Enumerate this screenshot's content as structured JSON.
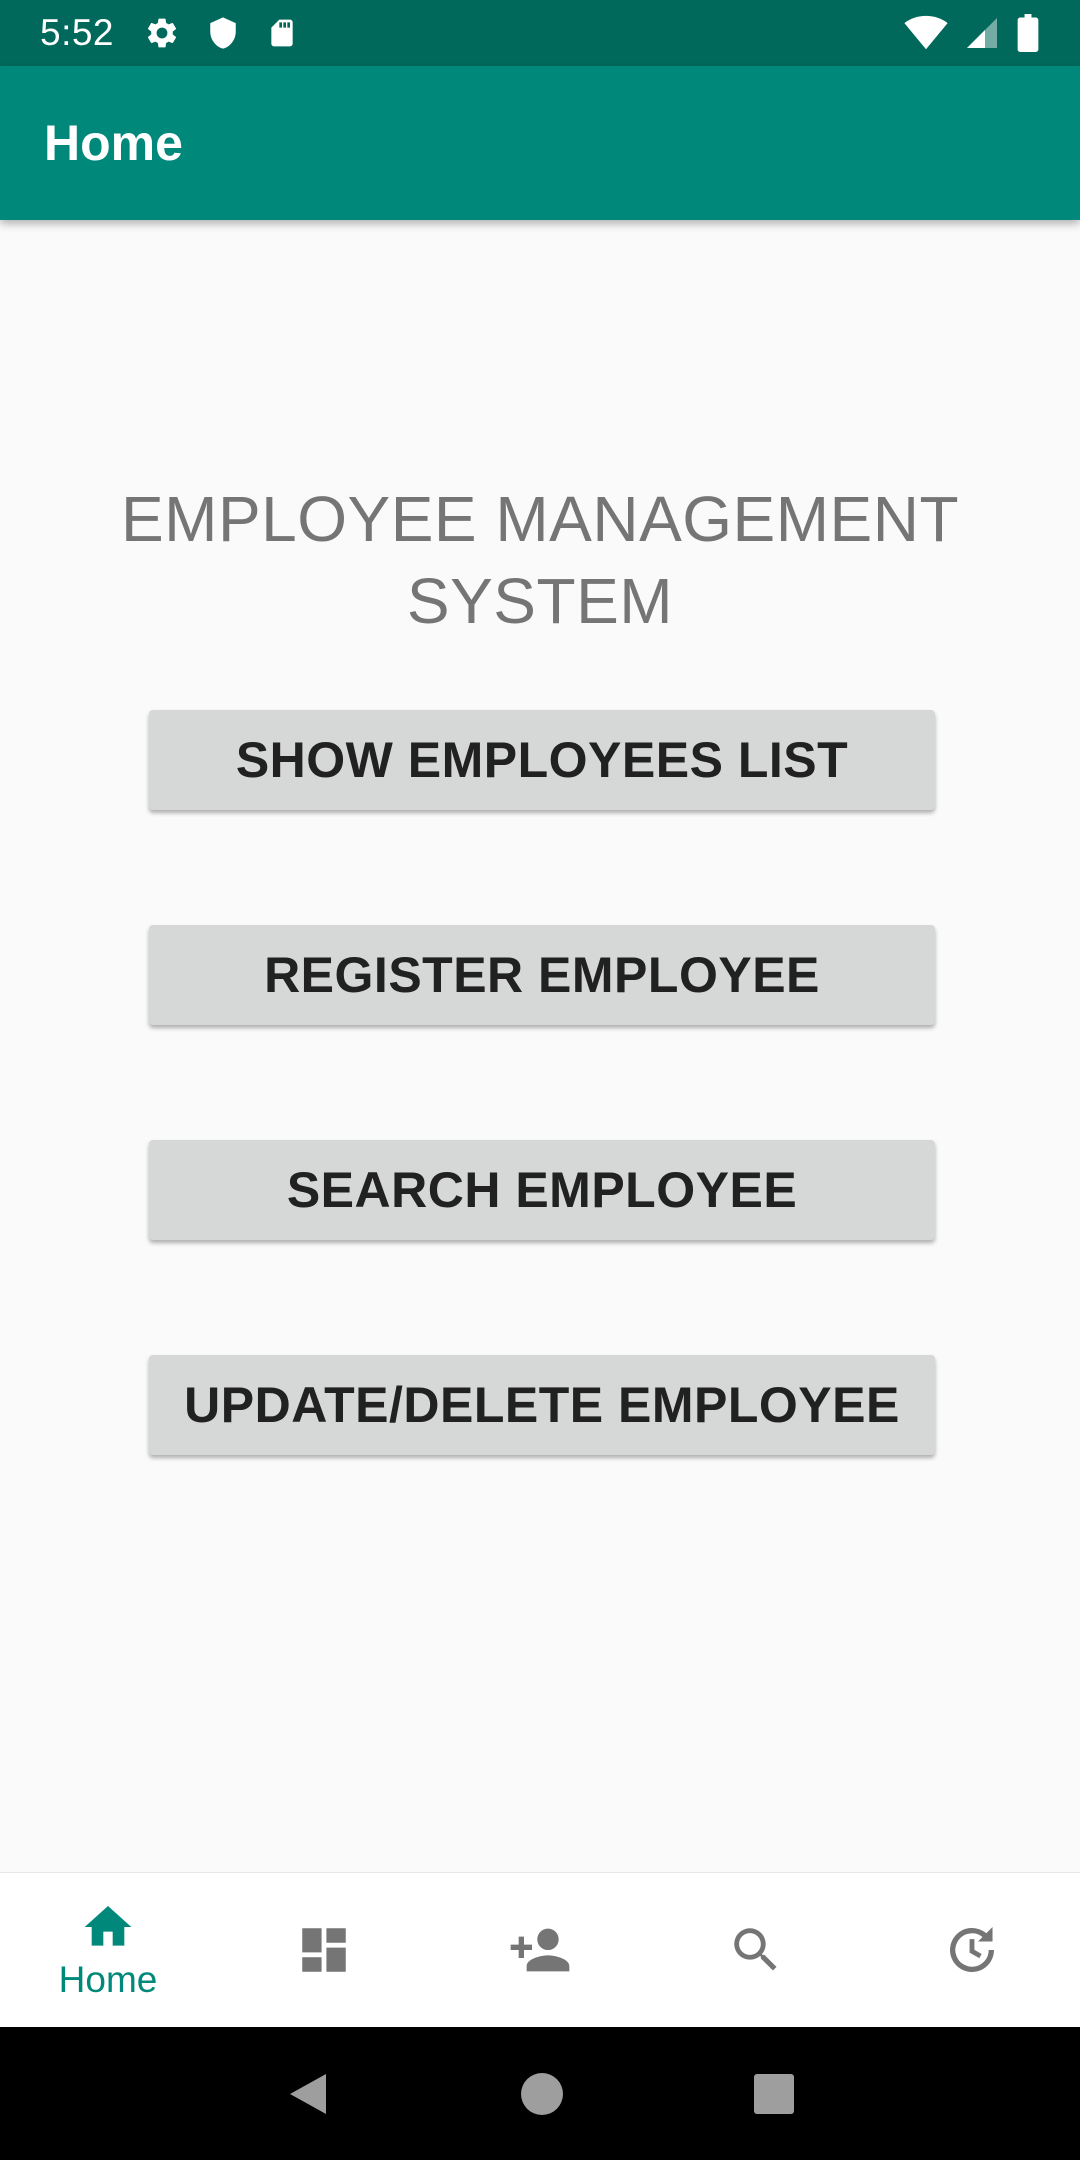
{
  "status_bar": {
    "time": "5:52",
    "left_icons": [
      "gear-icon",
      "shield-icon",
      "sd-card-icon"
    ],
    "right_icons": [
      "wifi-icon",
      "signal-icon",
      "battery-icon"
    ]
  },
  "app_bar": {
    "title": "Home"
  },
  "main": {
    "title": "EMPLOYEE MANAGEMENT SYSTEM",
    "buttons": [
      {
        "label": "SHOW EMPLOYEES LIST"
      },
      {
        "label": "REGISTER EMPLOYEE"
      },
      {
        "label": "SEARCH EMPLOYEE"
      },
      {
        "label": "UPDATE/DELETE EMPLOYEE"
      }
    ]
  },
  "bottom_nav": {
    "items": [
      {
        "icon": "home-icon",
        "label": "Home",
        "selected": true
      },
      {
        "icon": "dashboard-icon",
        "label": "",
        "selected": false
      },
      {
        "icon": "add-person-icon",
        "label": "",
        "selected": false
      },
      {
        "icon": "search-icon",
        "label": "",
        "selected": false
      },
      {
        "icon": "history-icon",
        "label": "",
        "selected": false
      }
    ]
  },
  "system_nav": [
    "back-icon",
    "home-circle-icon",
    "recents-icon"
  ],
  "colors": {
    "status_bar": "#00695c",
    "app_bar": "#00897b",
    "accent": "#00897b",
    "button_bg": "#d6d7d7",
    "title_text": "#757575",
    "inactive_icon": "#757575"
  }
}
